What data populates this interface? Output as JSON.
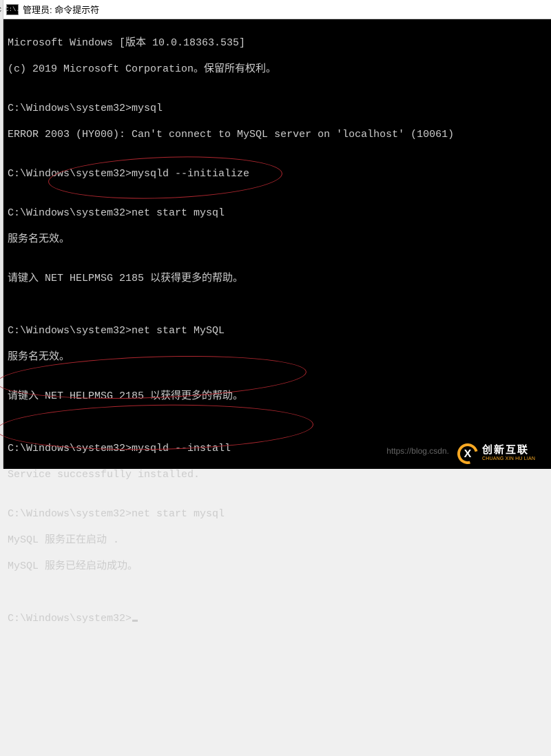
{
  "window": {
    "icon_text": "C:\\.",
    "title": "管理员: 命令提示符"
  },
  "terminal": {
    "lines": [
      "Microsoft Windows [版本 10.0.18363.535]",
      "(c) 2019 Microsoft Corporation。保留所有权利。",
      "",
      "C:\\Windows\\system32>mysql",
      "ERROR 2003 (HY000): Can't connect to MySQL server on 'localhost' (10061)",
      "",
      "C:\\Windows\\system32>mysqld --initialize",
      "",
      "C:\\Windows\\system32>net start mysql",
      "服务名无效。",
      "",
      "请键入 NET HELPMSG 2185 以获得更多的帮助。",
      "",
      "",
      "C:\\Windows\\system32>net start MySQL",
      "服务名无效。",
      "",
      "请键入 NET HELPMSG 2185 以获得更多的帮助。",
      "",
      "",
      "C:\\Windows\\system32>mysqld --install",
      "Service successfully installed.",
      "",
      "C:\\Windows\\system32>net start mysql",
      "MySQL 服务正在启动 .",
      "MySQL 服务已经启动成功。",
      "",
      ""
    ],
    "prompt": "C:\\Windows\\system32>"
  },
  "watermark": "https://blog.csdn.",
  "logo": {
    "cn": "创新互联",
    "en": "CHUANG XIN HU LIAN"
  }
}
